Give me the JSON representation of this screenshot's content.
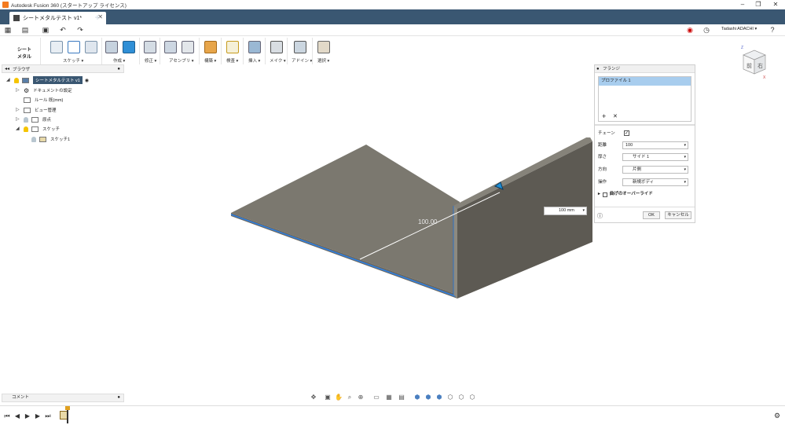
{
  "window": {
    "title": "Autodesk Fusion 360 (スタートアップ ライセンス)"
  },
  "tab": {
    "label": "シートメタルテスト v1*"
  },
  "user": {
    "name": "Tadashi ADACHI ▾"
  },
  "ribbon": {
    "workspace": "シート\nメタル",
    "groups": [
      "スケッチ ▾",
      "作成 ▾",
      "修正 ▾",
      "アセンブリ ▾",
      "構築 ▾",
      "検査 ▾",
      "挿入 ▾",
      "メイク ▾",
      "アドイン ▾",
      "選択 ▾"
    ]
  },
  "browser": {
    "title": "ブラウザ",
    "root": "シートメタルテスト v1",
    "items": [
      "ドキュメントの設定",
      "ルール 既(mm)",
      "ビュー管理",
      "原点",
      "スケッチ",
      "スケッチ1"
    ]
  },
  "viewcube": {
    "front": "前",
    "right": "右",
    "axis_z": "Z",
    "axis_x": "X"
  },
  "model": {
    "dim_label": "100.00"
  },
  "flange_panel": {
    "title": "フランジ",
    "profile": "プロファイル 1",
    "chain_label": "チェーン",
    "distance_label": "距離",
    "distance_value": "100",
    "thickness_label": "厚さ",
    "thickness_value": "サイド 1",
    "direction_label": "方向",
    "direction_value": "片側",
    "operation_label": "操作",
    "operation_value": "新規ボディ",
    "override_label": "曲げのオーバーライド",
    "ok": "OK",
    "cancel": "キャンセル"
  },
  "dim_input": {
    "value": "100 mm"
  },
  "comment": {
    "label": "コメント"
  }
}
